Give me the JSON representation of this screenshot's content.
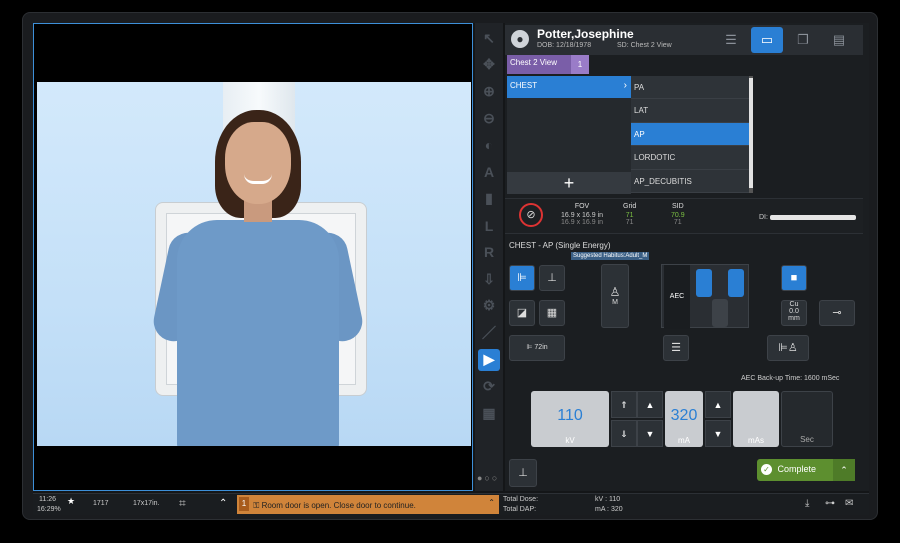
{
  "patient": {
    "name": "Potter,Josephine",
    "dob": "DOB: 12/18/1978",
    "study": "SD: Chest 2 View"
  },
  "view_tab": {
    "label": "Chest 2 View",
    "count": "1"
  },
  "body_parts": [
    {
      "label": "CHEST",
      "selected": true
    }
  ],
  "add_button": "+",
  "projections": [
    {
      "label": "PA"
    },
    {
      "label": "LAT"
    },
    {
      "label": "AP",
      "selected": true
    },
    {
      "label": "LORDOTIC"
    },
    {
      "label": "AP_DECUBITIS"
    }
  ],
  "params": {
    "fov_label": "FOV",
    "fov_value": "16.9 x 16.9 in",
    "fov_sub": "16.9 x 16.9 in",
    "grid_label": "Grid",
    "grid_value": "71",
    "grid_sub": "71",
    "sid_label": "SID",
    "sid_value": "70.9",
    "sid_sub": "71",
    "di_label": "DI:"
  },
  "exam": {
    "title": "CHEST - AP (Single Energy)",
    "habitus": "Suggested Habitus:Adult_M"
  },
  "controls": {
    "sid_72": "72in",
    "patient_size": "M",
    "aec_label": "AEC",
    "cu_label": "Cu",
    "cu_value": "0.0",
    "cu_unit": "mm",
    "aec_backup": "AEC Back-up Time: 1600 mSec"
  },
  "technique": {
    "kv_value": "110",
    "kv_unit": "kV",
    "ma_value": "320",
    "ma_unit": "mA",
    "mas_value": "",
    "mas_unit": "mAs",
    "sec_value": "",
    "sec_unit": "Sec"
  },
  "complete_label": "Complete",
  "status": {
    "time": "11:26",
    "seconds": "16:29%",
    "count": "1717",
    "size": "17x17in.",
    "message_count": "1",
    "message": "Room door is open. Close door to continue.",
    "total_dose_label": "Total Dose:",
    "total_dap_label": "Total DAP:",
    "kv_readout": "kV : 110",
    "mas_readout": "mA : 320"
  },
  "colors": {
    "accent": "#2a7fd4",
    "view_tab": "#7a5ea8",
    "complete": "#5d8f2f",
    "alert": "#d0843a"
  }
}
